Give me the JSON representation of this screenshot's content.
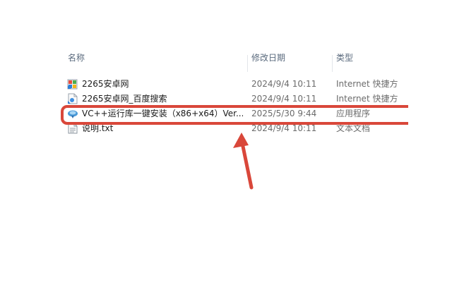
{
  "columns": {
    "name": "名称",
    "date_modified": "修改日期",
    "type": "类型"
  },
  "files": [
    {
      "name": "2265安卓网",
      "date": "2024/9/4 10:11",
      "type": "Internet 快捷方",
      "icon": "internet-shortcut-icon"
    },
    {
      "name": "2265安卓网_百度搜索",
      "date": "2024/9/4 10:11",
      "type": "Internet 快捷方",
      "icon": "internet-shortcut-icon"
    },
    {
      "name": "VC++运行库一键安装（x86+x64）Ver...",
      "date": "2025/5/30 9:44",
      "type": "应用程序",
      "icon": "application-icon"
    },
    {
      "name": "说明.txt",
      "date": "2024/9/4 10:11",
      "type": "文本文档",
      "icon": "text-document-icon"
    }
  ],
  "colors": {
    "annotation": "#d9473a",
    "header_text": "#5a6a7d",
    "meta_text": "#6b6b6b"
  }
}
